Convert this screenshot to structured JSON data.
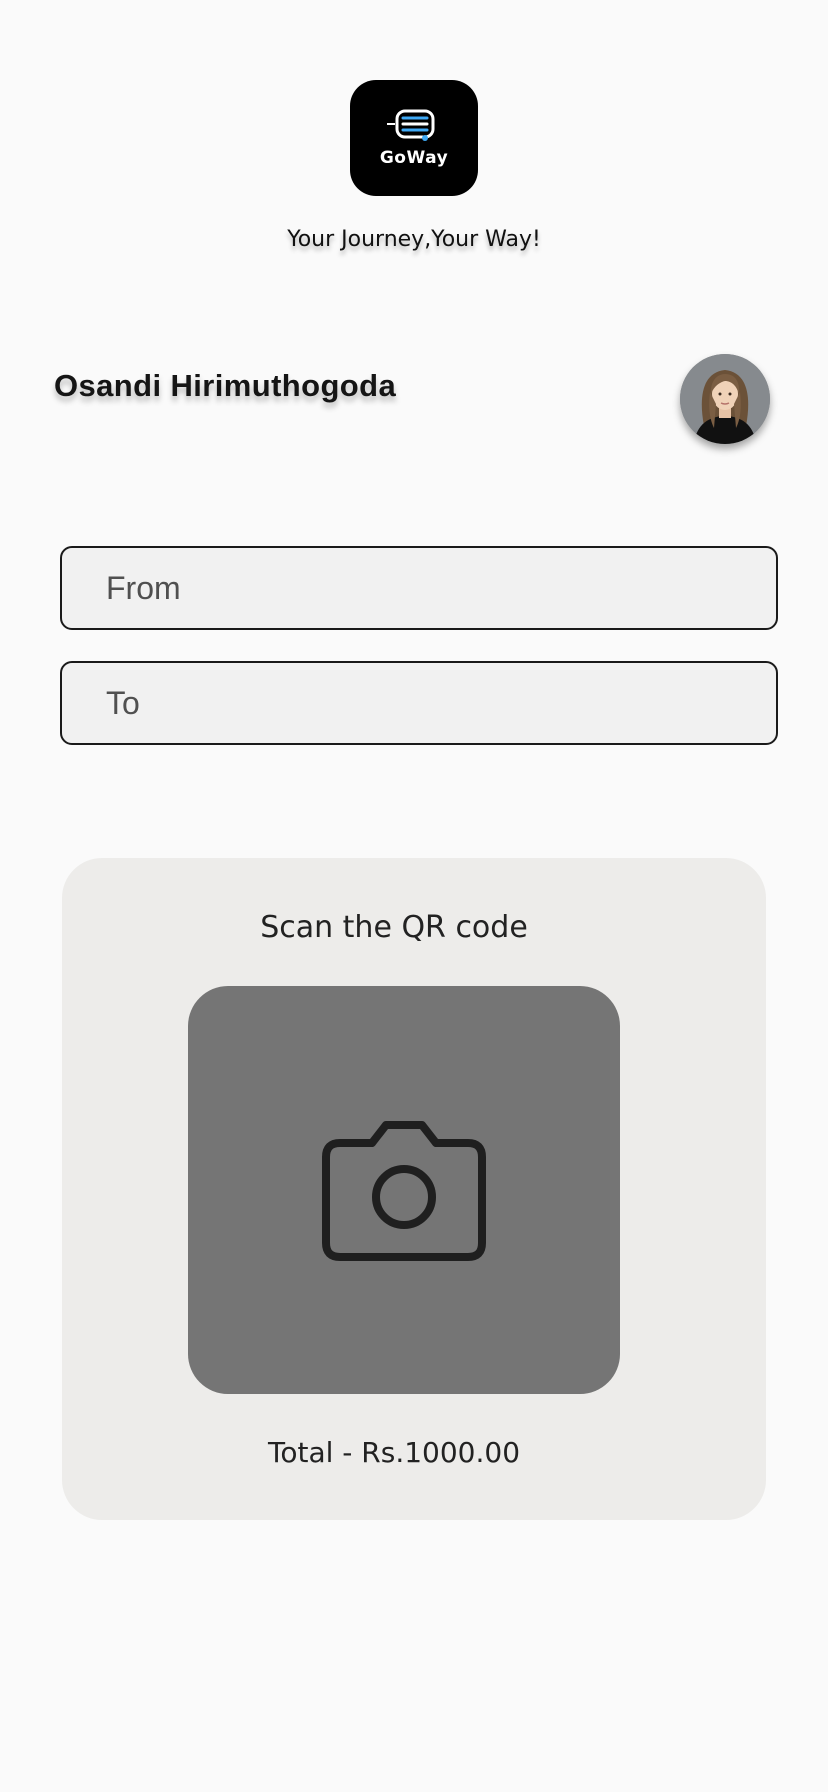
{
  "app": {
    "logo_text": "GoWay",
    "tagline": "Your Journey,Your Way!"
  },
  "user": {
    "name": "Osandi Hirimuthogoda",
    "avatar_icon": "user-avatar-photo"
  },
  "trip": {
    "from_placeholder": "From",
    "to_placeholder": "To"
  },
  "qr": {
    "title": "Scan the QR code",
    "icon": "camera-icon",
    "total": "Total - Rs.1000.00"
  },
  "colors": {
    "background": "#fafafa",
    "logo_bg": "#000000",
    "accent_blue": "#3fa9f5",
    "card_bg": "#edecea",
    "camera_box": "#757575"
  }
}
